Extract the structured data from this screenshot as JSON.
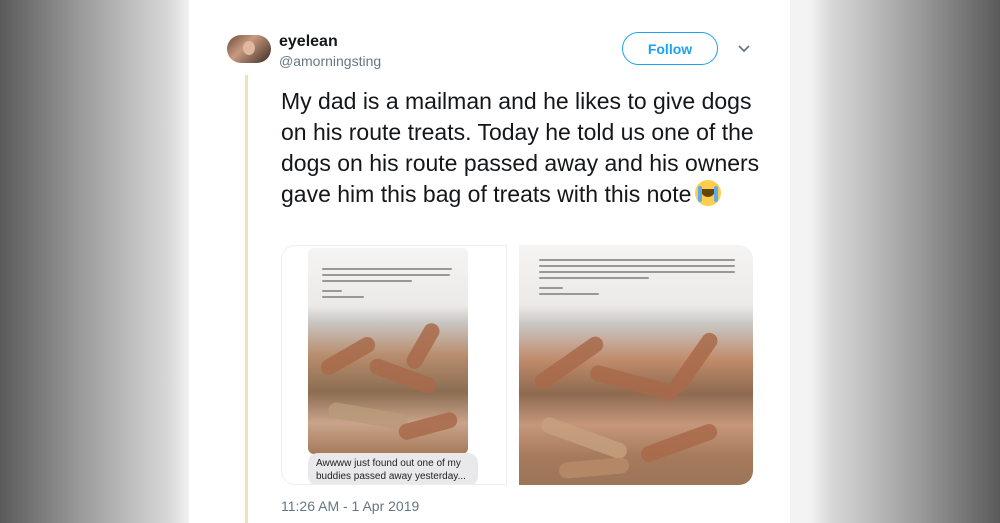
{
  "user": {
    "name": "eyelean",
    "handle": "@amorningsting"
  },
  "follow_label": "Follow",
  "tweet": {
    "text": "My dad is a mailman and he likes to give dogs on his route treats. Today he told us one of the dogs on his route passed away and his owners gave him this bag of treats with this note",
    "emoji": "loudly-crying-face"
  },
  "media": {
    "message_bubble": "Awwww just found out one of my buddies passed away yesterday... Gretchen was a huge German"
  },
  "timestamp": "11:26 AM - 1 Apr 2019",
  "colors": {
    "accent": "#1da1f2",
    "text": "#14171a",
    "secondary": "#657786",
    "thread_line": "#f1e2b3"
  }
}
